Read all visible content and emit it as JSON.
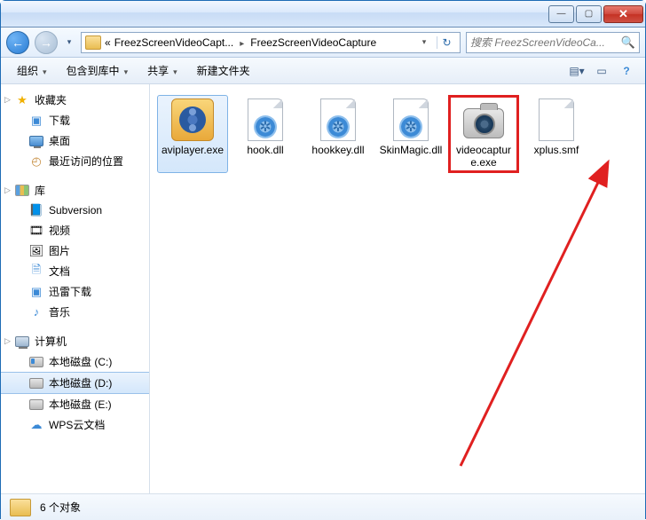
{
  "titlebar": {
    "min": "—",
    "max": "▢",
    "close": "✕"
  },
  "nav": {
    "back": "←",
    "fwd": "→",
    "crumb_prefix": "«",
    "crumb1": "FreezScreenVideoCapt...",
    "crumb2": "FreezScreenVideoCapture",
    "refresh": "↻",
    "search_placeholder": "搜索 FreezScreenVideoCa..."
  },
  "toolbar": {
    "organize": "组织",
    "include": "包含到库中",
    "share": "共享",
    "newfolder": "新建文件夹",
    "view": "▤",
    "help": "?"
  },
  "sidebar": {
    "favorites": {
      "label": "收藏夹",
      "items": [
        "下载",
        "桌面",
        "最近访问的位置"
      ]
    },
    "libraries": {
      "label": "库",
      "items": [
        "Subversion",
        "视频",
        "图片",
        "文档",
        "迅雷下载",
        "音乐"
      ]
    },
    "computer": {
      "label": "计算机",
      "items": [
        "本地磁盘 (C:)",
        "本地磁盘 (D:)",
        "本地磁盘 (E:)",
        "WPS云文档"
      ]
    }
  },
  "files": [
    {
      "name": "aviplayer.exe",
      "type": "avi-exe"
    },
    {
      "name": "hook.dll",
      "type": "dll"
    },
    {
      "name": "hookkey.dll",
      "type": "dll"
    },
    {
      "name": "SkinMagic.dll",
      "type": "dll"
    },
    {
      "name": "videocapture.exe",
      "type": "cam-exe",
      "highlighted": true
    },
    {
      "name": "xplus.smf",
      "type": "blank"
    }
  ],
  "status": {
    "count": "6 个对象"
  }
}
